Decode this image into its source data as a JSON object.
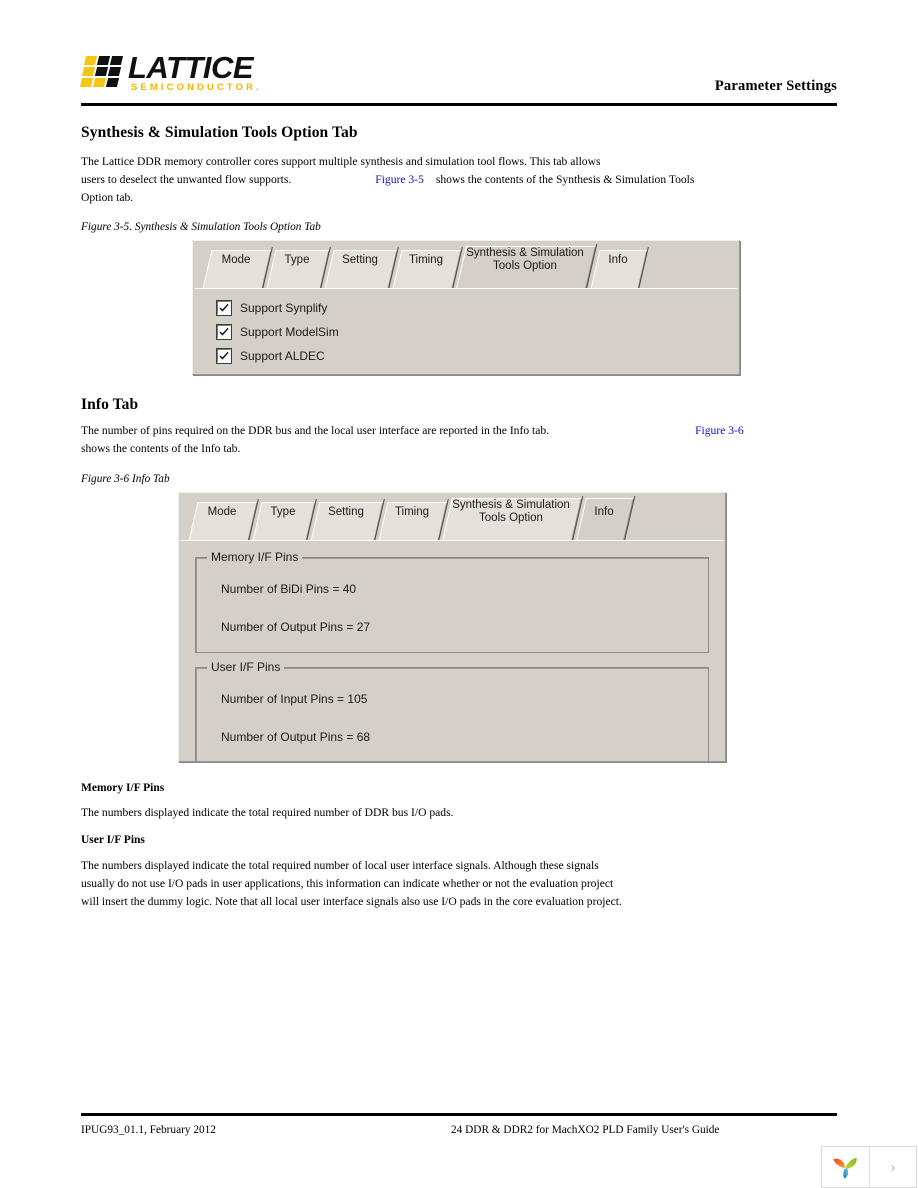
{
  "header": {
    "logo_text": "LATTICE",
    "logo_subtext": "SEMICONDUCTOR.",
    "title": "Parameter Settings"
  },
  "sections": {
    "synthesis": {
      "heading": "Synthesis & Simulation Tools Option Tab",
      "para_line1": "The Lattice DDR memory controller cores support multiple synthesis and simulation tool flows. This tab allows",
      "para_line2a": "users to deselect the unwanted flow supports.",
      "para_link": "Figure 3-5",
      "para_line2b": "shows the contents of the Synthesis & Simulation Tools",
      "para_line3": "Option tab.",
      "figure_caption": "Figure 3-5. Synthesis & Simulation Tools Option Tab"
    },
    "info": {
      "heading": "Info Tab",
      "para_line1": "The number of pins required on the DDR bus and the local user interface are reported in the Info tab.",
      "para_link": "Figure 3-6",
      "para_line2": "shows the contents of the Info tab.",
      "figure_caption": "Figure 3-6 Info Tab"
    },
    "memory_if": {
      "heading": "Memory I/F Pins",
      "body": "The numbers displayed indicate the total required number of DDR bus I/O pads."
    },
    "user_if": {
      "heading": "User I/F Pins",
      "body_line1": "The numbers displayed indicate the total required number of local user interface signals. Although these signals",
      "body_line2": "usually do not use I/O pads in user applications, this information can indicate whether or not the evaluation project",
      "body_line3": "will insert the dummy logic. Note that all local user interface signals also use I/O pads in the core evaluation project."
    }
  },
  "dialog_synthesis": {
    "tabs": [
      {
        "label": "Mode",
        "selected": false
      },
      {
        "label": "Type",
        "selected": false
      },
      {
        "label": "Setting",
        "selected": false
      },
      {
        "label": "Timing",
        "selected": false
      },
      {
        "label": "Synthesis & Simulation\nTools Option",
        "line1": "Synthesis & Simulation",
        "line2": "Tools Option",
        "selected": true
      },
      {
        "label": "Info",
        "selected": false
      }
    ],
    "checkboxes": [
      {
        "label": "Support Synplify",
        "checked": true
      },
      {
        "label": "Support ModelSim",
        "checked": true
      },
      {
        "label": "Support ALDEC",
        "checked": true
      }
    ]
  },
  "dialog_info": {
    "tabs": [
      {
        "label": "Mode",
        "selected": false
      },
      {
        "label": "Type",
        "selected": false
      },
      {
        "label": "Setting",
        "selected": false
      },
      {
        "label": "Timing",
        "selected": false
      },
      {
        "label": "Synthesis & Simulation\nTools Option",
        "line1": "Synthesis & Simulation",
        "line2": "Tools Option",
        "selected": false
      },
      {
        "label": "Info",
        "selected": true
      }
    ],
    "groups": [
      {
        "title": "Memory I/F Pins",
        "lines": [
          "Number of BiDi Pins = 40",
          "Number of Output Pins = 27"
        ]
      },
      {
        "title": "User I/F Pins",
        "lines": [
          "Number of Input Pins = 105",
          "Number of Output Pins = 68"
        ]
      }
    ]
  },
  "footer": {
    "left": "IPUG93_01.1, February 2012",
    "center": "24 DDR & DDR2 for MachXO2 PLD Family User's Guide"
  },
  "widget": {
    "chevron": "›"
  },
  "colors": {
    "logo_yellow": "#F5C518",
    "logo_black": "#111111",
    "link_blue": "#1111CC",
    "dialog_face": "#D4D0C8",
    "tab_face": "#E4E1DB"
  }
}
